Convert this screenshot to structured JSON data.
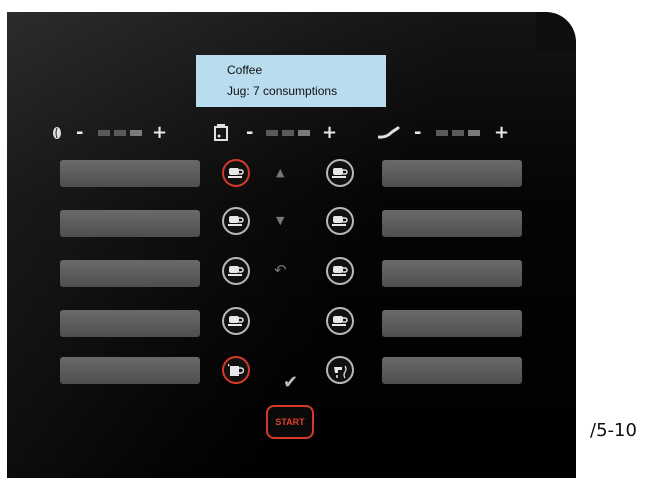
{
  "display": {
    "line1": "Coffee",
    "line2": "Jug: 7 consumptions"
  },
  "controls": {
    "bean": {
      "icon": "bean-icon",
      "minus": "-",
      "plus": "+"
    },
    "water": {
      "icon": "water-tank-icon",
      "minus": "-",
      "plus": "+"
    },
    "milk": {
      "icon": "milk-spout-icon",
      "minus": "-",
      "plus": "+"
    }
  },
  "left_slots_count": 5,
  "right_slots_count": 5,
  "buttons": {
    "left": [
      "cup-icon",
      "cup-icon",
      "cup-icon",
      "cup-icon",
      "jug-icon"
    ],
    "right": [
      "cup-icon",
      "cup-icon",
      "cup-icon",
      "cup-icon",
      "hot-water-icon"
    ],
    "selected": [
      "left-1",
      "left-5"
    ]
  },
  "navigation": {
    "up": "▲",
    "down": "▼",
    "back": "↶"
  },
  "confirm_symbol": "✔",
  "start_label": "START",
  "side_note": "/5-10",
  "colors": {
    "accent": "#d43a2a",
    "display_bg": "#b9dcee"
  }
}
